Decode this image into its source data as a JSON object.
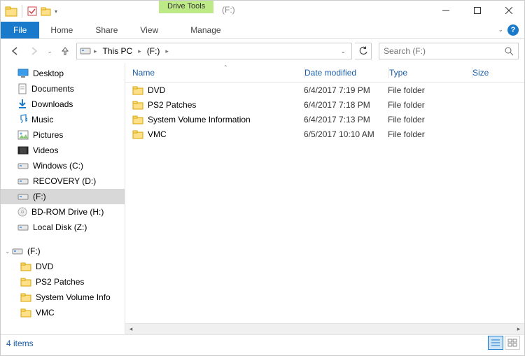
{
  "title": "(F:)",
  "drive_tools_label": "Drive Tools",
  "ribbon": {
    "file": "File",
    "home": "Home",
    "share": "Share",
    "view": "View",
    "manage": "Manage"
  },
  "breadcrumbs": [
    "This PC",
    "(F:)"
  ],
  "search_placeholder": "Search (F:)",
  "columns": {
    "name": "Name",
    "date": "Date modified",
    "type": "Type",
    "size": "Size"
  },
  "nav_tree": [
    {
      "label": "Desktop",
      "icon": "desktop",
      "indent": 24
    },
    {
      "label": "Documents",
      "icon": "doc",
      "indent": 24
    },
    {
      "label": "Downloads",
      "icon": "download",
      "indent": 24
    },
    {
      "label": "Music",
      "icon": "music",
      "indent": 24
    },
    {
      "label": "Pictures",
      "icon": "pictures",
      "indent": 24
    },
    {
      "label": "Videos",
      "icon": "videos",
      "indent": 24
    },
    {
      "label": "Windows (C:)",
      "icon": "drive",
      "indent": 24
    },
    {
      "label": "RECOVERY (D:)",
      "icon": "drive",
      "indent": 24
    },
    {
      "label": "(F:)",
      "icon": "drive",
      "indent": 24,
      "selected": true
    },
    {
      "label": "BD-ROM Drive (H:)",
      "icon": "disc",
      "indent": 24
    },
    {
      "label": "Local Disk (Z:)",
      "icon": "drive",
      "indent": 24
    },
    {
      "label": "",
      "icon": "",
      "indent": 24,
      "spacer": true
    },
    {
      "label": "(F:)",
      "icon": "drive",
      "indent": 16,
      "root": true
    },
    {
      "label": "DVD",
      "icon": "folder",
      "indent": 28
    },
    {
      "label": "PS2 Patches",
      "icon": "folder",
      "indent": 28
    },
    {
      "label": "System Volume Info",
      "icon": "folder",
      "indent": 28
    },
    {
      "label": "VMC",
      "icon": "folder",
      "indent": 28
    }
  ],
  "files": [
    {
      "name": "DVD",
      "date": "6/4/2017 7:19 PM",
      "type": "File folder"
    },
    {
      "name": "PS2 Patches",
      "date": "6/4/2017 7:18 PM",
      "type": "File folder"
    },
    {
      "name": "System Volume Information",
      "date": "6/4/2017 7:13 PM",
      "type": "File folder"
    },
    {
      "name": "VMC",
      "date": "6/5/2017 10:10 AM",
      "type": "File folder"
    }
  ],
  "status": "4 items"
}
